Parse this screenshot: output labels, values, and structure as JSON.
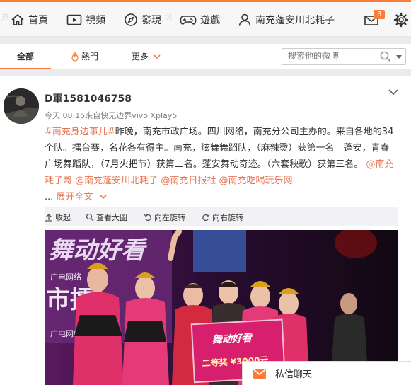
{
  "nav": {
    "items": [
      {
        "label": "首頁",
        "icon": "home-icon"
      },
      {
        "label": "視頻",
        "icon": "video-icon"
      },
      {
        "label": "發現",
        "icon": "discover-icon"
      },
      {
        "label": "遊戲",
        "icon": "game-icon"
      },
      {
        "label": "南充蓬安川北耗子",
        "icon": "user-icon"
      }
    ],
    "mail_badge": "3"
  },
  "tabs": {
    "all": "全部",
    "hot": "熱門",
    "more": "更多"
  },
  "search": {
    "placeholder": "搜索他的微博"
  },
  "post": {
    "username": "D軍1581046758",
    "meta": "今天 08:15來自快无边界vivo Xplay5",
    "text": {
      "tag": "#南充身边事儿#",
      "p1": "昨晚，南充市政广场。四川网络，南充分公司主办的。来自各地的34个队。擂台赛，名花各有得主。南充，炫舞舞蹈队，（麻辣烫）获第一名。蓬安，青春广场舞蹈队，（7月火把节）获第二名。蓬安舞动奇迹。（六套秧歌）获第三名。",
      "m1": "@南充耗子哥",
      "m2": "@南充蓬安川北耗子",
      "m3": "@南充日报社",
      "m4": "@南充吃喝玩乐网",
      "ellipsis": "...",
      "expand": "展开全文"
    },
    "tools": {
      "collapse": "收起",
      "view_large": "查看大圖",
      "rotate_left": "向左旋转",
      "rotate_right": "向右旋转"
    },
    "photo_text": {
      "banner_top": "舞动好看",
      "banner_mid": "市擂",
      "banner_small": "广电网络",
      "prize": "二等奖 ¥3000元",
      "sign": "舞动好看"
    }
  },
  "chat": {
    "label": "私信聊天"
  },
  "colors": {
    "accent": "#fa7d3c",
    "link": "#eb7350"
  }
}
